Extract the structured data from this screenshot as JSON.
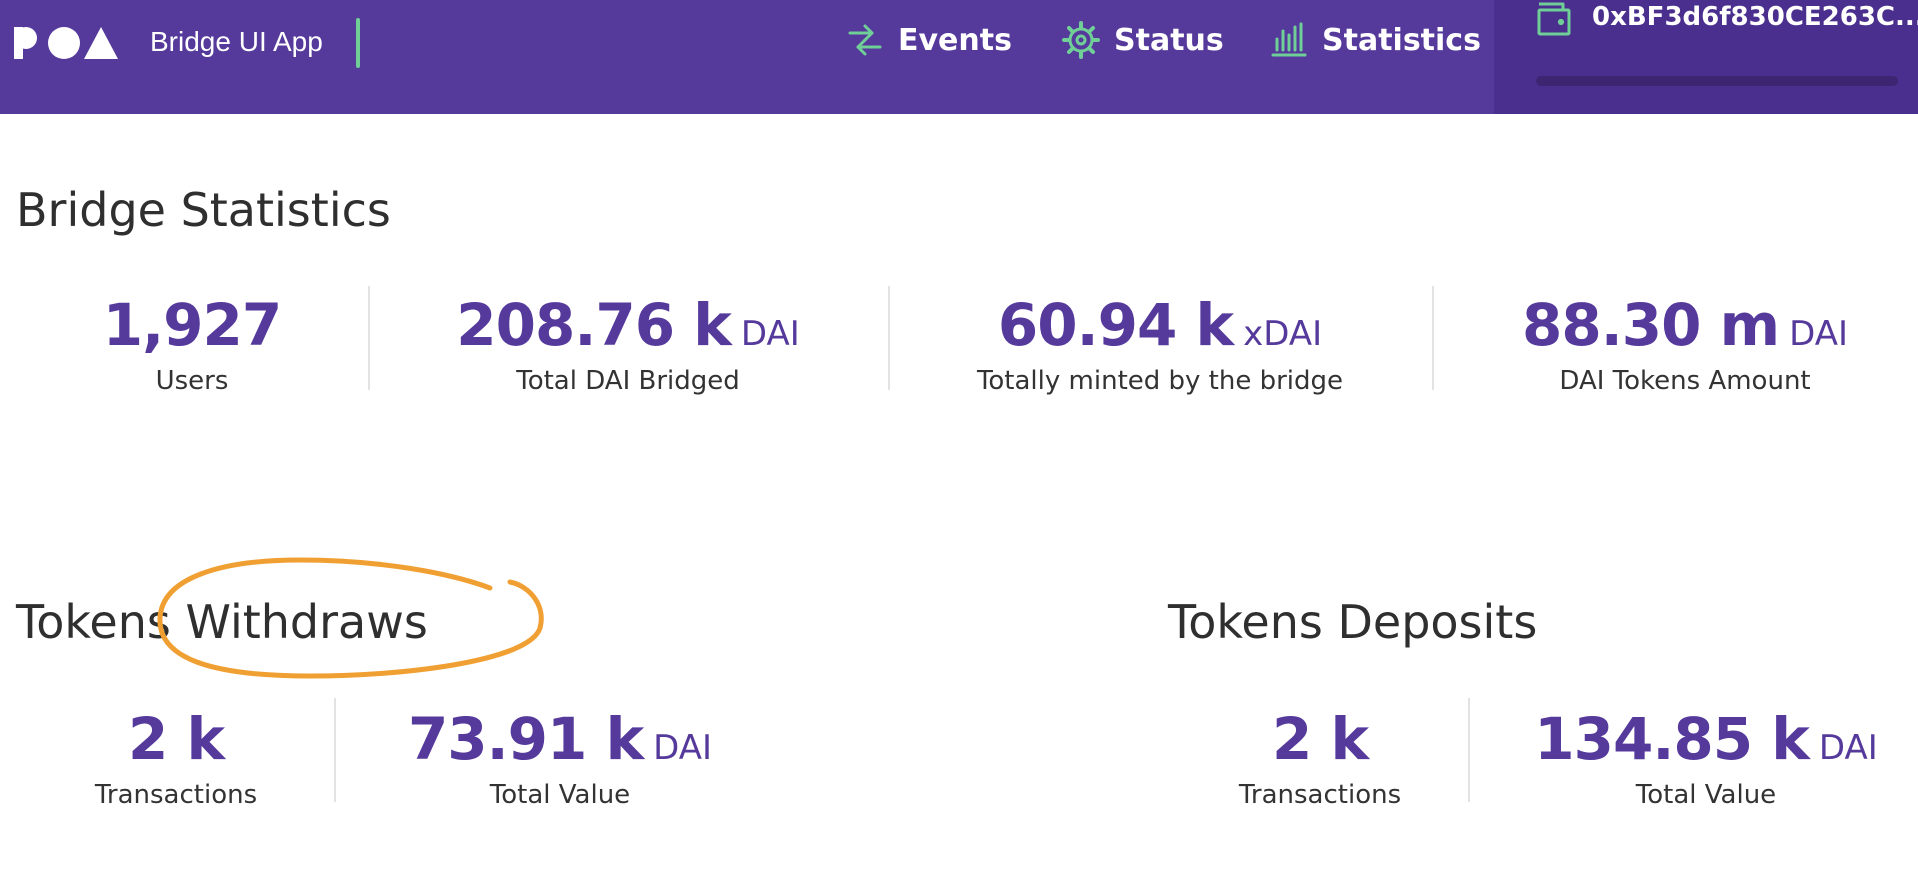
{
  "header": {
    "logo_text": "POA",
    "app_title": "Bridge UI App",
    "nav": {
      "events": "Events",
      "status": "Status",
      "statistics": "Statistics"
    },
    "wallet_address": "0xBF3d6f830CE263C...",
    "colors": {
      "background": "#553a9c",
      "accent": "#6fcf97"
    }
  },
  "bridge_statistics": {
    "title": "Bridge Statistics",
    "items": [
      {
        "value": "1,927",
        "unit": "",
        "label": "Users"
      },
      {
        "value": "208.76 k",
        "unit": "DAI",
        "label": "Total DAI Bridged"
      },
      {
        "value": "60.94 k",
        "unit": "xDAI",
        "label": "Totally minted by the bridge"
      },
      {
        "value": "88.30 m",
        "unit": "DAI",
        "label": "DAI Tokens Amount"
      }
    ]
  },
  "tokens_withdraws": {
    "title": "Tokens Withdraws",
    "transactions": {
      "value": "2 k",
      "label": "Transactions"
    },
    "total_value": {
      "value": "73.91 k",
      "unit": "DAI",
      "label": "Total Value"
    }
  },
  "tokens_deposits": {
    "title": "Tokens Deposits",
    "transactions": {
      "value": "2 k",
      "label": "Transactions"
    },
    "total_value": {
      "value": "134.85 k",
      "unit": "DAI",
      "label": "Total Value"
    }
  }
}
